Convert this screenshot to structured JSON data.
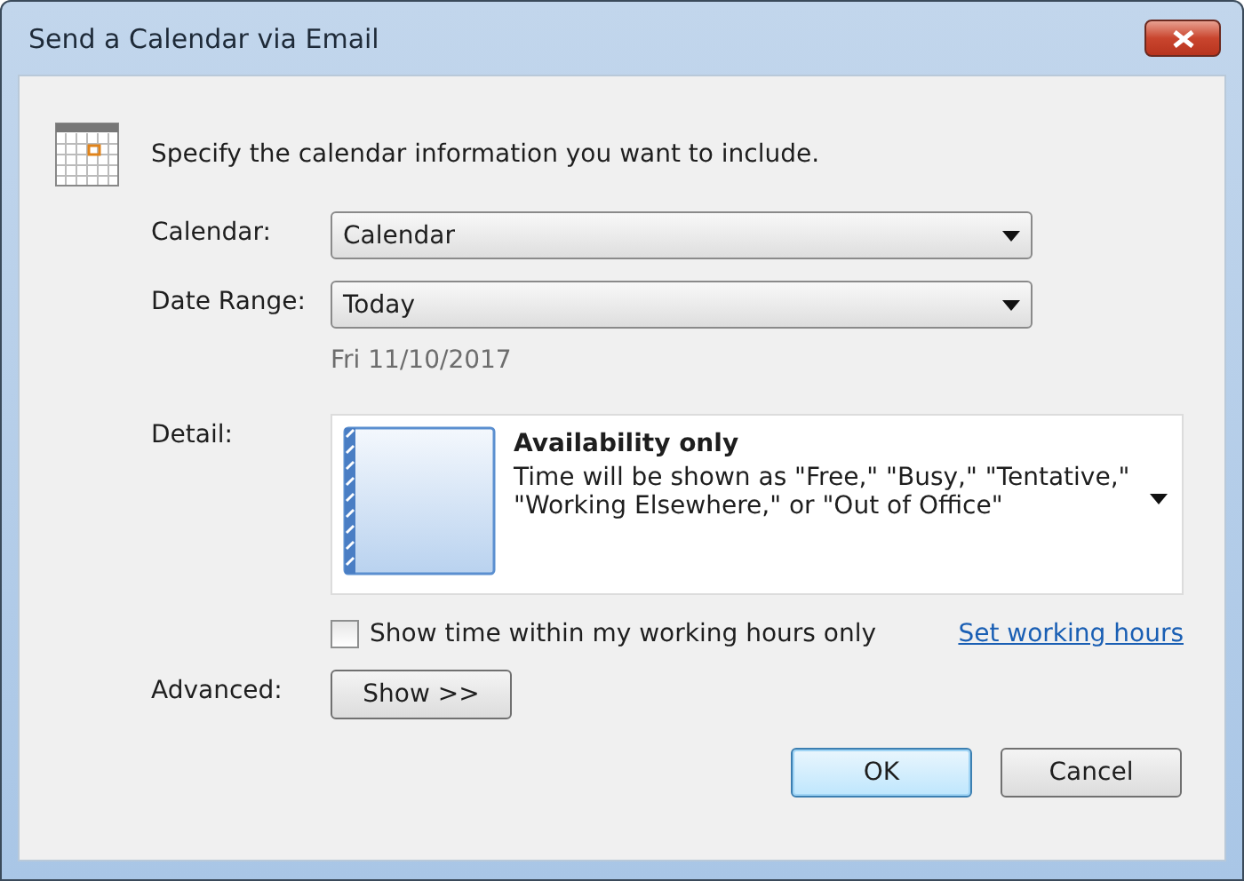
{
  "window": {
    "title": "Send a Calendar via Email"
  },
  "heading": "Specify the calendar information you want to include.",
  "calendar": {
    "label": "Calendar:",
    "value": "Calendar"
  },
  "date_range": {
    "label": "Date Range:",
    "value": "Today",
    "date": "Fri 11/10/2017"
  },
  "detail": {
    "label": "Detail:",
    "title": "Availability only",
    "description": "Time will be shown as \"Free,\" \"Busy,\" \"Tentative,\" \"Working Elsewhere,\" or \"Out of Office\""
  },
  "working_hours": {
    "label": "Show time within my working hours only",
    "checked": false,
    "link": "Set working hours"
  },
  "advanced": {
    "label": "Advanced:",
    "button": "Show >>"
  },
  "buttons": [
    {
      "label": "OK",
      "default": true
    },
    {
      "label": "Cancel",
      "default": false
    }
  ]
}
